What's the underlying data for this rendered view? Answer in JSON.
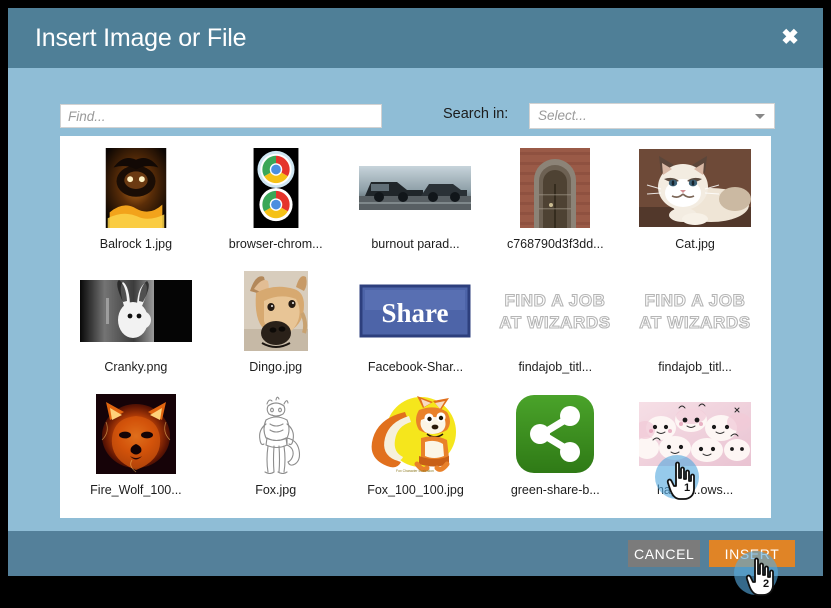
{
  "dialog": {
    "title": "Insert Image or File",
    "close_icon": "close-icon"
  },
  "search": {
    "find_placeholder": "Find...",
    "find_value": "",
    "search_in_label": "Search in:",
    "select_value": "Select...",
    "caret_icon": "chevron-down-icon"
  },
  "files": [
    {
      "label": "Balrock 1.jpg",
      "thumb": "balrock"
    },
    {
      "label": "browser-chrom...",
      "thumb": "chrome"
    },
    {
      "label": "burnout parad...",
      "thumb": "burnout"
    },
    {
      "label": "c768790d3f3dd...",
      "thumb": "door"
    },
    {
      "label": "Cat.jpg",
      "thumb": "cat"
    },
    {
      "label": "Cranky.png",
      "thumb": "cranky"
    },
    {
      "label": "Dingo.jpg",
      "thumb": "dingo"
    },
    {
      "label": "Facebook-Shar...",
      "thumb": "share"
    },
    {
      "label": "findajob_titl...",
      "thumb": "findajob"
    },
    {
      "label": "findajob_titl...",
      "thumb": "findajob"
    },
    {
      "label": "Fire_Wolf_100...",
      "thumb": "firewolf"
    },
    {
      "label": "Fox.jpg",
      "thumb": "foxsketch"
    },
    {
      "label": "Fox_100_100.jpg",
      "thumb": "foxcartoon"
    },
    {
      "label": "green-share-b...",
      "thumb": "greenshare"
    },
    {
      "label": "happy...ows...",
      "thumb": "happymarsh"
    }
  ],
  "footer": {
    "cancel_label": "CANCEL",
    "insert_label": "INSERT"
  },
  "cursors": {
    "first": "1",
    "second": "2"
  },
  "colors": {
    "header": "#4f7f97",
    "body": "#8fbdd6",
    "footer": "#54809a",
    "insert": "#e08426",
    "cancel": "#7b7b7b"
  }
}
